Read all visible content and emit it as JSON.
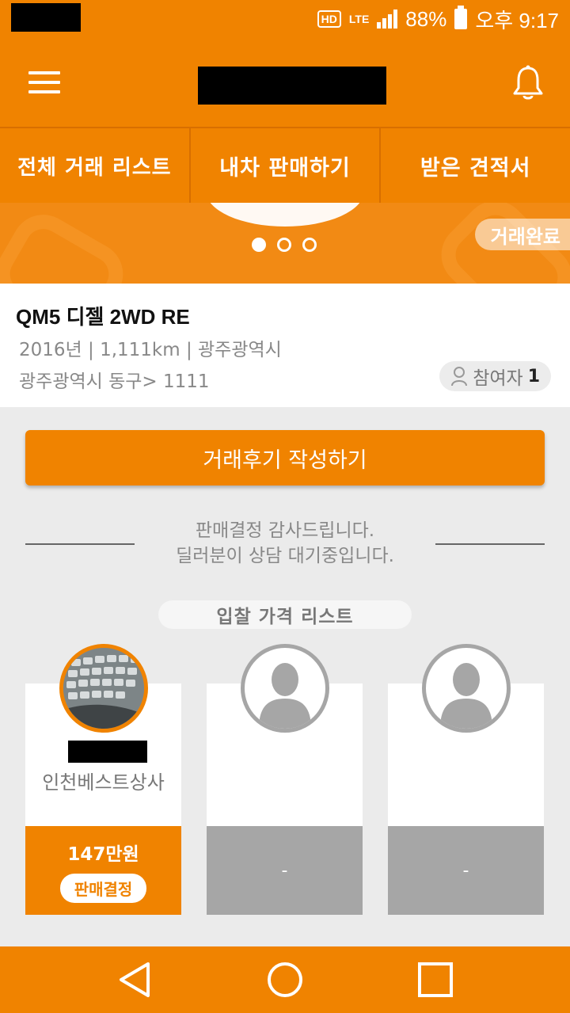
{
  "status_bar": {
    "hd": "HD",
    "network": "LTE",
    "battery": "88%",
    "time": "오후 9:17"
  },
  "app_bar": {
    "menu_icon": "hamburger-icon",
    "notification_icon": "bell-icon"
  },
  "tabs": [
    {
      "label": "전체 거래 리스트"
    },
    {
      "label": "내차 판매하기"
    },
    {
      "label": "받은 견적서"
    }
  ],
  "banner": {
    "badge": "거래완료",
    "page_count": 3,
    "active_page": 1
  },
  "listing": {
    "title": "QM5 디젤 2WD RE",
    "meta": "2016년 | 1,111km | 광주광역시",
    "location": "광주광역시 동구> 1111",
    "participants_label": "참여자",
    "participants_count": "1"
  },
  "review_button": "거래후기 작성하기",
  "message": {
    "line1": "판매결정 감사드립니다.",
    "line2": "딜러분이 상담 대기중입니다."
  },
  "bid_list_label": "입찰 가격 리스트",
  "bids": [
    {
      "dealer": "인천베스트상사",
      "price": "147만원",
      "status": "판매결정"
    },
    {
      "price": "-"
    },
    {
      "price": "-"
    }
  ],
  "nav": [
    "back-icon",
    "home-icon",
    "recents-icon"
  ],
  "colors": {
    "accent": "#f08300",
    "gray": "#a6a6a6",
    "background": "#ebebeb"
  }
}
